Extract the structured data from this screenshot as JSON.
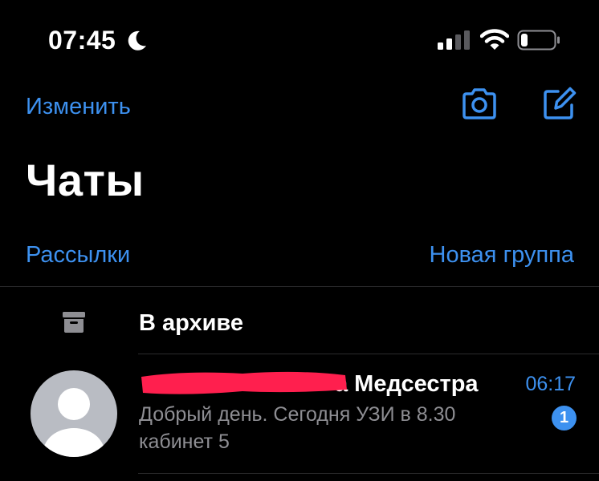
{
  "status_bar": {
    "time": "07:45",
    "moon_icon": "moon-icon",
    "signal_icon": "cellular-signal-icon",
    "wifi_icon": "wifi-icon",
    "battery_icon": "battery-icon",
    "battery_level": 0.15
  },
  "header": {
    "edit_label": "Изменить",
    "camera_icon": "camera-icon",
    "compose_icon": "compose-icon",
    "title": "Чаты",
    "broadcast_label": "Рассылки",
    "new_group_label": "Новая группа"
  },
  "archive": {
    "icon": "archive-box-icon",
    "label": "В архиве"
  },
  "chats": [
    {
      "name_visible": "а Медсестра",
      "time": "06:17",
      "preview": "Добрый день. Сегодня УЗИ в 8.30 кабинет 5",
      "unread": "1"
    }
  ],
  "colors": {
    "background": "#000000",
    "accent": "#3d91f0",
    "secondary_text": "#8e8e93",
    "divider": "#2b2b2d",
    "avatar_bg": "#b9bcc3",
    "redaction": "#ff1f4e"
  }
}
